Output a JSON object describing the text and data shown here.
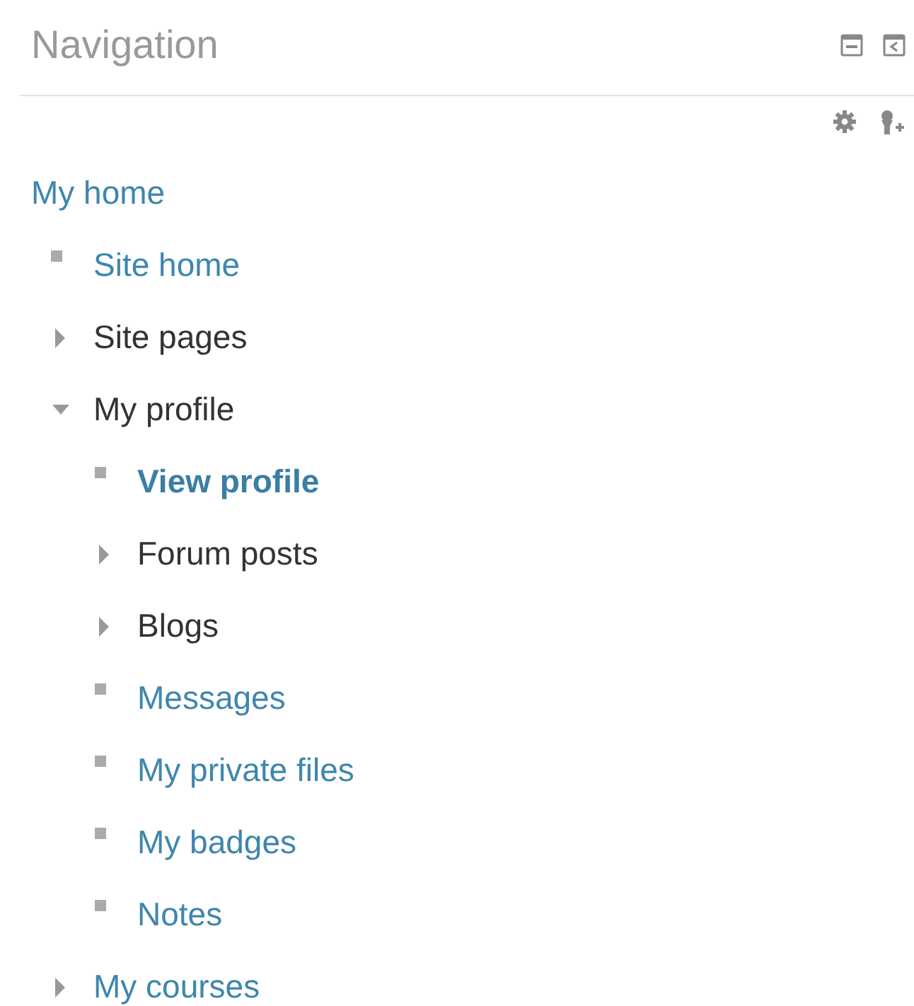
{
  "block": {
    "title": "Navigation"
  },
  "tree": [
    {
      "label": "My home",
      "kind": "heading",
      "link": true,
      "current": false,
      "children": [
        {
          "label": "Site home",
          "kind": "leaf",
          "link": true,
          "current": false
        },
        {
          "label": "Site pages",
          "kind": "branch",
          "expanded": false,
          "link": false,
          "current": false
        },
        {
          "label": "My profile",
          "kind": "branch",
          "expanded": true,
          "link": false,
          "current": false,
          "children": [
            {
              "label": "View profile",
              "kind": "leaf",
              "link": true,
              "current": true
            },
            {
              "label": "Forum posts",
              "kind": "branch",
              "expanded": false,
              "link": false,
              "current": false
            },
            {
              "label": "Blogs",
              "kind": "branch",
              "expanded": false,
              "link": false,
              "current": false
            },
            {
              "label": "Messages",
              "kind": "leaf",
              "link": true,
              "current": false
            },
            {
              "label": "My private files",
              "kind": "leaf",
              "link": true,
              "current": false
            },
            {
              "label": "My badges",
              "kind": "leaf",
              "link": true,
              "current": false
            },
            {
              "label": "Notes",
              "kind": "leaf",
              "link": true,
              "current": false
            }
          ]
        },
        {
          "label": "My courses",
          "kind": "branch",
          "expanded": false,
          "link": true,
          "current": false
        }
      ]
    }
  ]
}
